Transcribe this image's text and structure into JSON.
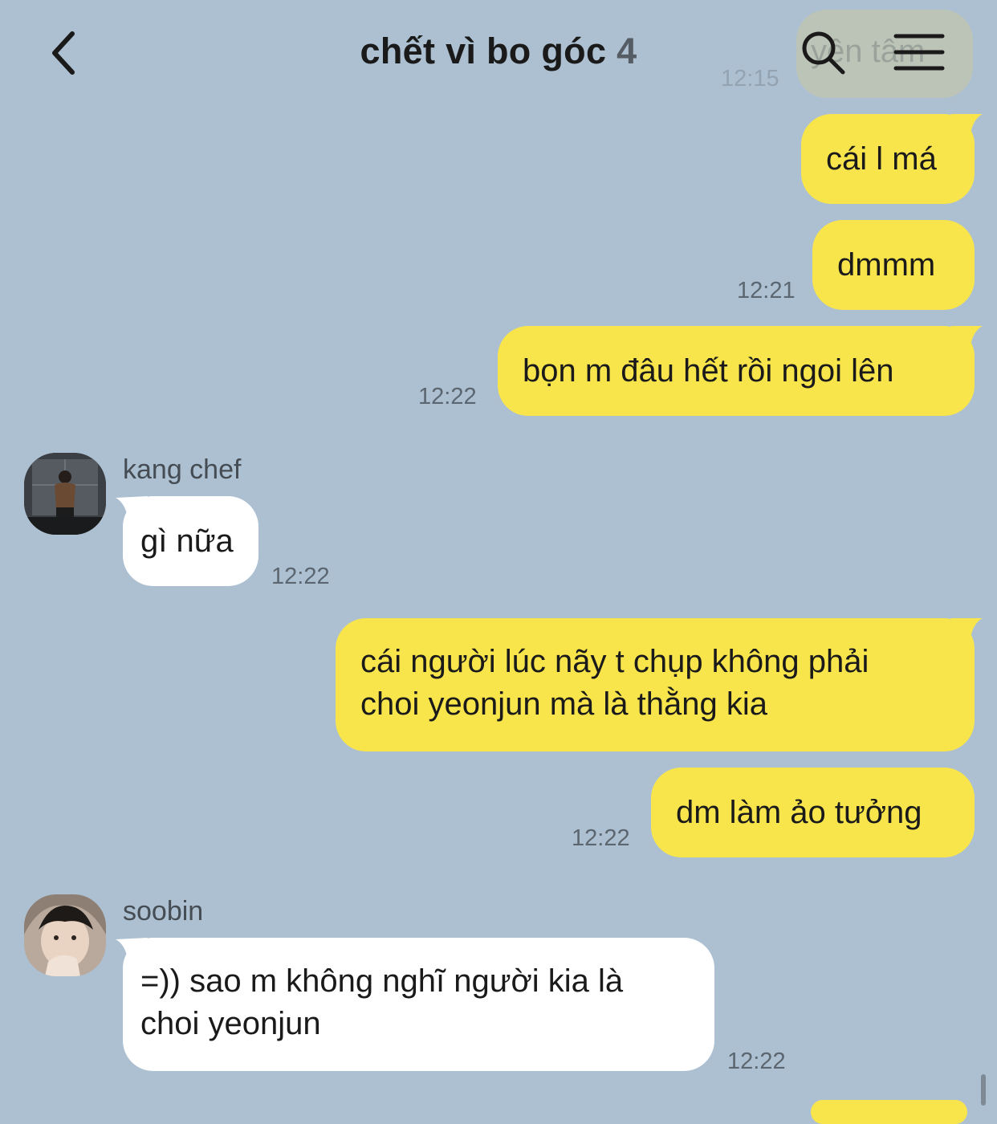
{
  "header": {
    "title": "chết vì bo góc",
    "member_count": "4",
    "back_icon": "chevron-left-icon",
    "search_icon": "search-icon",
    "menu_icon": "hamburger-menu-icon"
  },
  "faded_message": {
    "text": "yên tâm",
    "time": "12:15"
  },
  "messages": [
    {
      "text": "cái l má"
    },
    {
      "text": "dmmm",
      "time": "12:21"
    },
    {
      "text": "bọn m đâu hết rồi ngoi lên",
      "time": "12:22"
    },
    {
      "sender": "kang chef",
      "text": "gì nữa",
      "time": "12:22"
    },
    {
      "lines": [
        "cái người lúc nãy t chụp không phải",
        "choi yeonjun mà là thằng kia"
      ]
    },
    {
      "text": "dm làm ảo tưởng",
      "time": "12:22"
    },
    {
      "sender": "soobin",
      "lines": [
        "=)) sao m không nghĩ người kia là",
        "choi yeonjun"
      ],
      "time": "12:22"
    }
  ],
  "colors": {
    "background": "#adc0d1",
    "my_bubble": "#f8e54c",
    "their_bubble": "#ffffff"
  }
}
